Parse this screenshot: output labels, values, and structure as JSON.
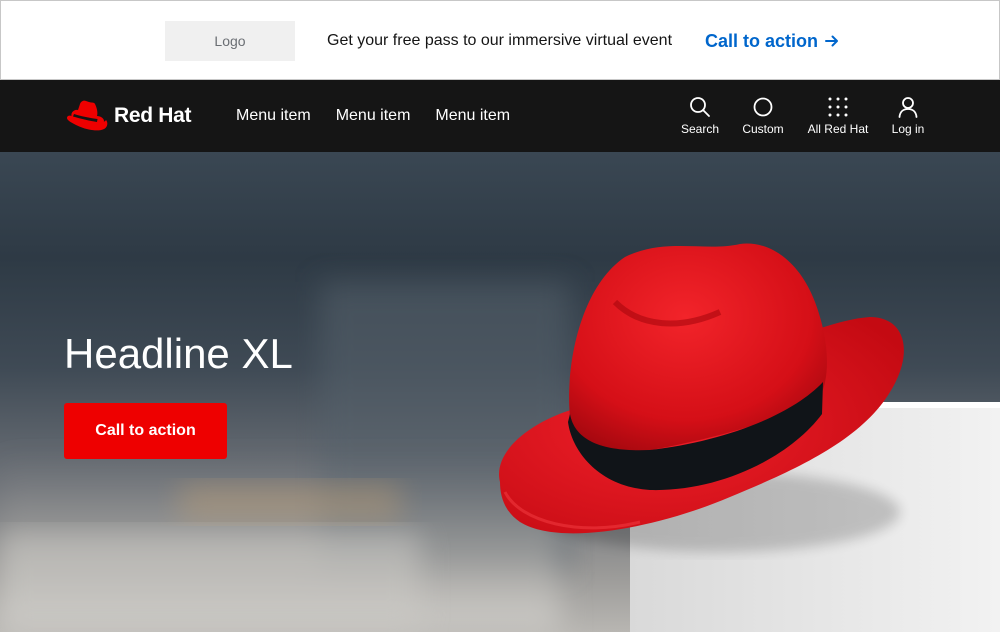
{
  "promo": {
    "logo_label": "Logo",
    "message": "Get your free pass to our immersive virtual event",
    "cta_label": "Call to action",
    "cta_color": "#0066cc"
  },
  "nav": {
    "brand_name": "Red Hat",
    "menu_items": [
      {
        "label": "Menu item"
      },
      {
        "label": "Menu item"
      },
      {
        "label": "Menu item"
      }
    ],
    "utilities": {
      "search": {
        "label": "Search",
        "icon": "search-icon"
      },
      "custom": {
        "label": "Custom",
        "icon": "circle-icon"
      },
      "all_red_hat": {
        "label": "All Red Hat",
        "icon": "grid-icon"
      },
      "log_in": {
        "label": "Log in",
        "icon": "user-icon"
      }
    },
    "background": "#151515"
  },
  "hero": {
    "headline": "Headline XL",
    "cta_label": "Call to action",
    "cta_color": "#ee0000",
    "image": "red-fedora-hat"
  }
}
